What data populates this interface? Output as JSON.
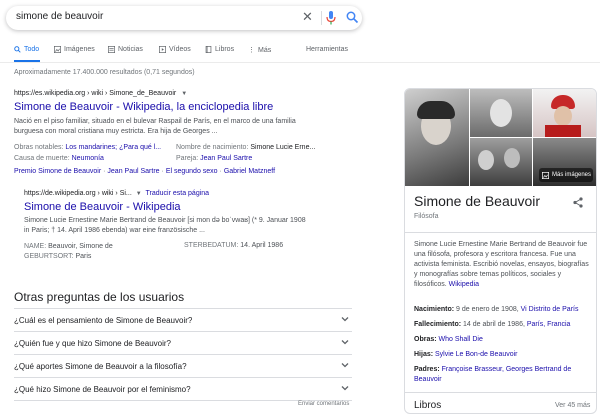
{
  "search": {
    "query": "simone de beauvoir"
  },
  "tabs": [
    {
      "label": "Todo"
    },
    {
      "label": "Imágenes"
    },
    {
      "label": "Noticias"
    },
    {
      "label": "Vídeos"
    },
    {
      "label": "Libros"
    },
    {
      "label": "Más"
    },
    {
      "label": "Herramientas"
    }
  ],
  "stats": "Aproximadamente 17.400.000 resultados (0,71 segundos)",
  "result1": {
    "url": "https://es.wikipedia.org › wiki › Simone_de_Beauvoir",
    "title": "Simone de Beauvoir - Wikipedia, la enciclopedia libre",
    "snippet1": "Nació en el piso familiar, situado en el bulevar Raspail de París, en el marco de una familia",
    "snippet2": "burguesa con moral cristiana muy estricta. Era hija de Georges ...",
    "facts": [
      {
        "key": "Obras notables:",
        "val": "Los mandarines; ¿Para qué l..."
      },
      {
        "key": "Nombre de nacimiento:",
        "val": "Simone Lucie Erne..."
      },
      {
        "key": "Causa de muerte:",
        "val": "Neumonía"
      },
      {
        "key": "Pareja:",
        "val": "Jean Paul Sartre"
      }
    ],
    "sitelinks": [
      "Premio Simone de Beauvoir",
      "Jean Paul Sartre",
      "El segundo sexo",
      "Gabriel Matzneff"
    ]
  },
  "result2": {
    "url": "https://de.wikipedia.org › wiki › Si...",
    "translate": "Traducir esta página",
    "title": "Simone de Beauvoir - Wikipedia",
    "snippet1": "Simone Lucie Ernestine Marie Bertrand de Beauvoir [si mon də boˈvwaʁ] (* 9. Januar 1908",
    "snippet2": "in Paris; † 14. April 1986 ebenda) war eine französische ...",
    "name_key": "NAME:",
    "name_val": "Beauvoir, Simone de",
    "death_key": "STERBEDATUM:",
    "death_val": "14. April 1986",
    "birth_key": "GEBURTSORT:",
    "birth_val": "Paris"
  },
  "paa": {
    "title": "Otras preguntas de los usuarios",
    "questions": [
      "¿Cuál es el pensamiento de Simone de Beauvoir?",
      "¿Quién fue y que hizo Simone de Beauvoir?",
      "¿Qué aportes Simone de Beauvoir a la filosofía?",
      "¿Qué hizo Simone de Beauvoir por el feminismo?"
    ],
    "feedback": "Enviar comentarios"
  },
  "knowledge_panel": {
    "more_images": "Más imágenes",
    "name": "Simone de Beauvoir",
    "subtitle": "Filósofa",
    "description": "Simone Lucie Ernestine Marie Bertrand de Beauvoir fue una filósofa, profesora y escritora francesa. Fue una activista feminista. Escribió novelas, ensayos, biografías y monografías sobre temas políticos, sociales y filosóficos.",
    "description_link": "Wikipedia",
    "facts": [
      {
        "key": "Nacimiento:",
        "val": "9 de enero de 1908, ",
        "link": "Vi Distrito de París"
      },
      {
        "key": "Fallecimiento:",
        "val": "14 de abril de 1986, ",
        "link": "París, Francia"
      },
      {
        "key": "Obras:",
        "val": "",
        "link": "Who Shall Die"
      },
      {
        "key": "Hijas:",
        "val": "",
        "link": "Sylvie Le Bon-de Beauvoir"
      },
      {
        "key": "Padres:",
        "val": "",
        "link": "Françoise Brasseur, Georges Bertrand de Beauvoir"
      }
    ],
    "books_title": "Libros",
    "books_more": "Ver 45 más"
  },
  "colors": {
    "accent": "#1a73e8",
    "link": "#1a0dab",
    "mic": "#ea4335"
  }
}
